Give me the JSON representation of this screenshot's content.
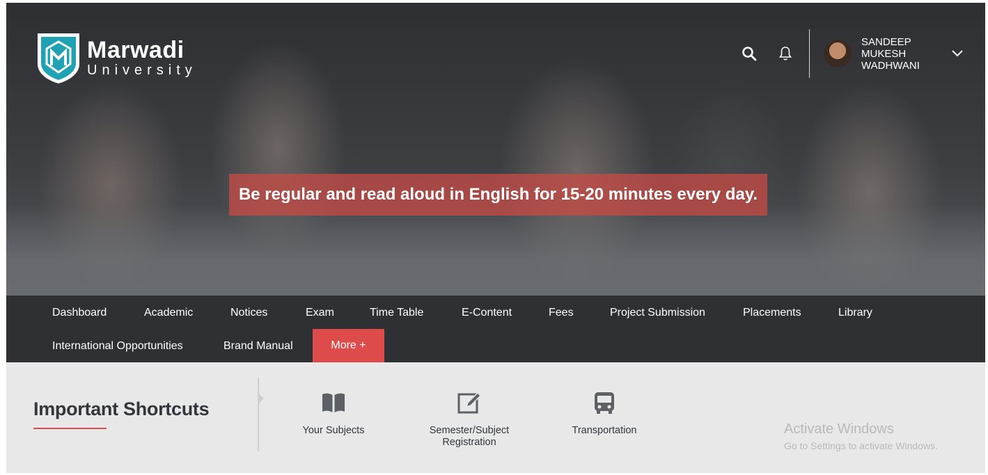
{
  "brand": {
    "name": "Marwadi",
    "sub": "University"
  },
  "header": {
    "user_name": "SANDEEP MUKESH WADHWANI"
  },
  "hero": {
    "quote": "Be regular and read aloud in English for 15-20 minutes every day."
  },
  "nav": {
    "items": [
      "Dashboard",
      "Academic",
      "Notices",
      "Exam",
      "Time Table",
      "E-Content",
      "Fees",
      "Project Submission",
      "Placements",
      "Library",
      "International Opportunities",
      "Brand Manual"
    ],
    "more": "More +"
  },
  "shortcuts": {
    "title": "Important Shortcuts",
    "items": [
      {
        "label": "Your Subjects",
        "icon": "book-icon"
      },
      {
        "label": "Semester/Subject Registration",
        "icon": "edit-icon"
      },
      {
        "label": "Transportation",
        "icon": "bus-icon"
      }
    ]
  },
  "watermark": {
    "line1": "Activate Windows",
    "line2": "Go to Settings to activate Windows."
  },
  "colors": {
    "accent": "#dd4b4a",
    "nav_bg": "#2e3034",
    "shortcuts_bg": "#e8e8e8",
    "brand_teal": "#1fa3b4"
  }
}
